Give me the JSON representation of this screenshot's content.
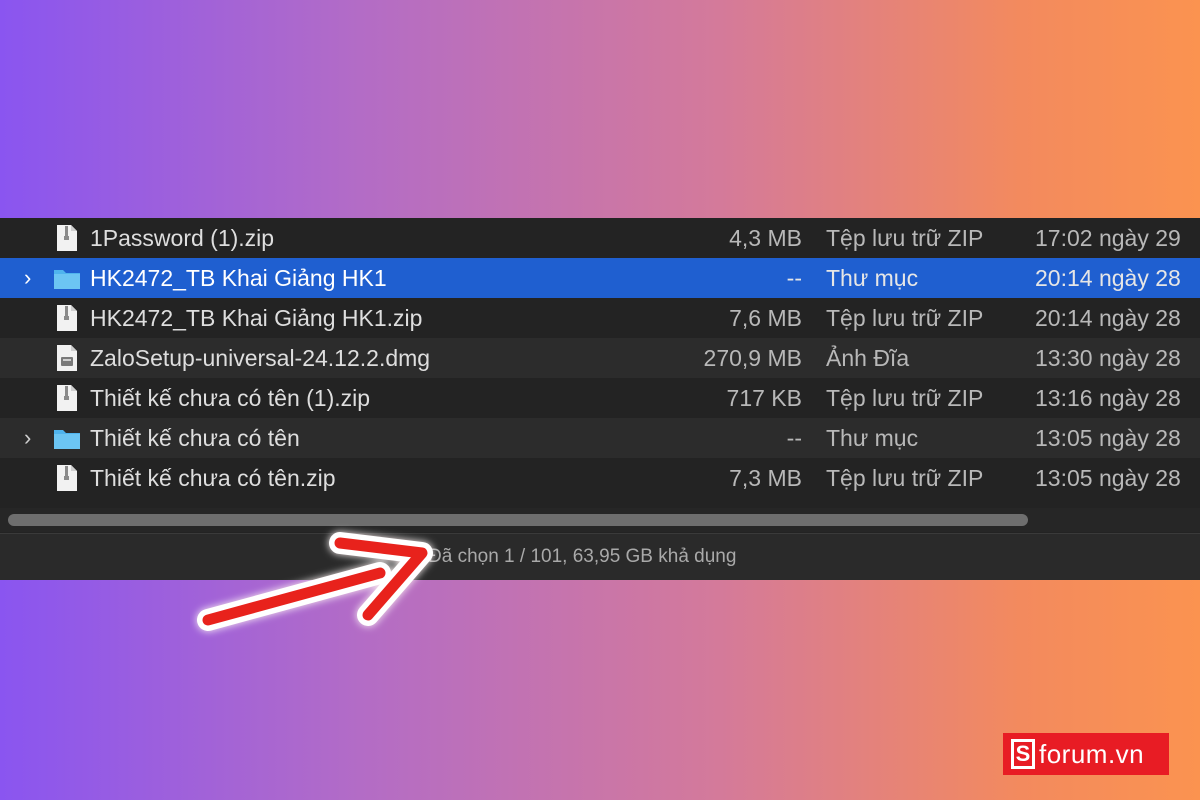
{
  "files": [
    {
      "name": "1Password (1).zip",
      "size": "4,3 MB",
      "kind": "Tệp lưu trữ ZIP",
      "date": "17:02 ngày 29",
      "type": "zip"
    },
    {
      "name": "HK2472_TB Khai Giảng HK1",
      "size": "--",
      "kind": "Thư mục",
      "date": "20:14 ngày 28",
      "type": "folder",
      "selected": true
    },
    {
      "name": "HK2472_TB Khai Giảng HK1.zip",
      "size": "7,6 MB",
      "kind": "Tệp lưu trữ ZIP",
      "date": "20:14 ngày 28",
      "type": "zip"
    },
    {
      "name": "ZaloSetup-universal-24.12.2.dmg",
      "size": "270,9 MB",
      "kind": "Ảnh Đĩa",
      "date": "13:30 ngày 28",
      "type": "dmg"
    },
    {
      "name": "Thiết kế chưa có tên (1).zip",
      "size": "717 KB",
      "kind": "Tệp lưu trữ ZIP",
      "date": "13:16 ngày 28",
      "type": "zip"
    },
    {
      "name": "Thiết kế chưa có tên",
      "size": "--",
      "kind": "Thư mục",
      "date": "13:05 ngày 28",
      "type": "folder"
    },
    {
      "name": "Thiết kế chưa có tên.zip",
      "size": "7,3 MB",
      "kind": "Tệp lưu trữ ZIP",
      "date": "13:05 ngày 28",
      "type": "zip"
    }
  ],
  "status": {
    "text": "Đã chọn 1 / 101, 63,95 GB khả dụng"
  },
  "chevron": "›",
  "watermark": {
    "s": "S",
    "text": "forum.vn"
  },
  "colors": {
    "selection": "#1f5fd0",
    "folder": "#4fb4ee",
    "arrow": "#e8231f",
    "brand": "#e81c24"
  }
}
